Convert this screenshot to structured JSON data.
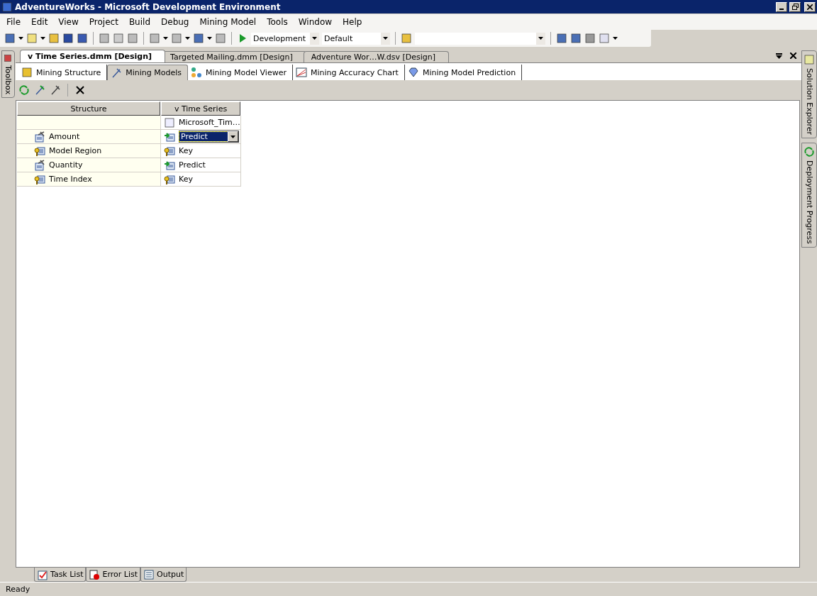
{
  "window": {
    "title": "AdventureWorks - Microsoft Development Environment"
  },
  "menu": [
    "File",
    "Edit",
    "View",
    "Project",
    "Build",
    "Debug",
    "Mining Model",
    "Tools",
    "Window",
    "Help"
  ],
  "toolbar": {
    "configuration": "Development",
    "platform": "Default"
  },
  "left_panels": [
    {
      "label": "Toolbox"
    }
  ],
  "right_panels": [
    {
      "label": "Solution Explorer",
      "kind": "solution"
    },
    {
      "label": "Deployment Progress",
      "kind": "deploy"
    }
  ],
  "document_tabs": [
    {
      "label": "v Time Series.dmm [Design]",
      "selected": true
    },
    {
      "label": "Targeted Mailing.dmm [Design]",
      "selected": false
    },
    {
      "label": "Adventure Wor…W.dsv [Design]",
      "selected": false
    }
  ],
  "designer_tabs": [
    {
      "label": "Mining Structure",
      "kind": "structure",
      "selected": false
    },
    {
      "label": "Mining Models",
      "kind": "models",
      "selected": true
    },
    {
      "label": "Mining Model Viewer",
      "kind": "viewer",
      "selected": false
    },
    {
      "label": "Mining Accuracy Chart",
      "kind": "accuracy",
      "selected": false
    },
    {
      "label": "Mining Model Prediction",
      "kind": "prediction",
      "selected": false
    }
  ],
  "grid": {
    "columns": [
      "Structure",
      "v Time Series"
    ],
    "algorithm": "Microsoft_Tim…",
    "rows": [
      {
        "name": "Amount",
        "kind": "column",
        "usage": {
          "label": "Predict",
          "kind": "predict"
        },
        "selected": true
      },
      {
        "name": "Model Region",
        "kind": "key",
        "usage": {
          "label": "Key",
          "kind": "key"
        },
        "selected": false
      },
      {
        "name": "Quantity",
        "kind": "column",
        "usage": {
          "label": "Predict",
          "kind": "predict"
        },
        "selected": false
      },
      {
        "name": "Time Index",
        "kind": "key",
        "usage": {
          "label": "Key",
          "kind": "key"
        },
        "selected": false
      }
    ]
  },
  "bottom_tabs": [
    {
      "label": "Task List",
      "kind": "task"
    },
    {
      "label": "Error List",
      "kind": "error"
    },
    {
      "label": "Output",
      "kind": "output"
    }
  ],
  "status_bar": "Ready"
}
